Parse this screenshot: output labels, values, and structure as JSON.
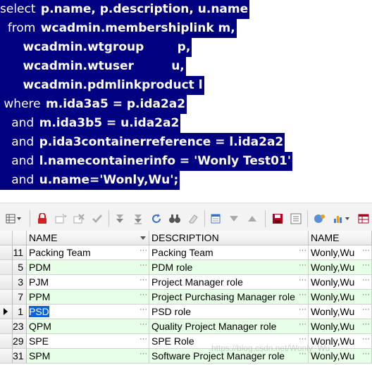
{
  "sql": {
    "lines": [
      {
        "kw": "select",
        "rest": "p.name, p.description, u.name"
      },
      {
        "kw": "from",
        "rest": "wcadmin.membershiplink m,"
      },
      {
        "kw": "",
        "rest": "wcadmin.wtgroup        p,"
      },
      {
        "kw": "",
        "rest": "wcadmin.wtuser         u,"
      },
      {
        "kw": "",
        "rest": "wcadmin.pdmlinkproduct l"
      },
      {
        "kw": "where",
        "rest": "m.ida3a5 = p.ida2a2"
      },
      {
        "kw": "and",
        "rest": "m.ida3b5 = u.ida2a2"
      },
      {
        "kw": "and",
        "rest": "p.ida3containerreference = l.ida2a2"
      },
      {
        "kw": "and",
        "rest": "l.namecontainerinfo = 'Wonly Test01'"
      },
      {
        "kw": "and",
        "rest": "u.name='Wonly,Wu';"
      }
    ]
  },
  "toolbar": {
    "icons": [
      "grid-options-icon",
      "lock-icon",
      "add-record-icon",
      "delete-record-icon",
      "post-icon",
      "filter-down-icon",
      "filter-down2-icon",
      "refresh-icon",
      "find-icon",
      "clear-icon",
      "export-icon",
      "triangle-down-icon",
      "triangle-up-icon",
      "save-icon",
      "query-by-example-icon",
      "chart-icon",
      "table-icon"
    ],
    "colors": {
      "lock": "#cc2222",
      "save": "#b00020",
      "accent": "#3a6fd0"
    }
  },
  "grid": {
    "columns": [
      "NAME",
      "DESCRIPTION",
      "NAME"
    ],
    "rows": [
      {
        "num": "11",
        "name": "Packing Team",
        "description": "Packing Team",
        "user": "Wonly,Wu",
        "shade": "#ffffff",
        "current": false
      },
      {
        "num": "5",
        "name": "PDM",
        "description": "PDM role",
        "user": "Wonly,Wu",
        "shade": "#e6ffe6",
        "current": false
      },
      {
        "num": "3",
        "name": "PJM",
        "description": "Project Manager role",
        "user": "Wonly,Wu",
        "shade": "#ffffff",
        "current": false
      },
      {
        "num": "7",
        "name": "PPM",
        "description": "Project Purchasing Manager role",
        "user": "Wonly,Wu",
        "shade": "#e6ffe6",
        "current": false
      },
      {
        "num": "1",
        "name": "PSD",
        "description": "PSD role",
        "user": "Wonly,Wu",
        "shade": "#ffffff",
        "current": true
      },
      {
        "num": "23",
        "name": "QPM",
        "description": "Quality Project Manager role",
        "user": "Wonly,Wu",
        "shade": "#e6ffe6",
        "current": false
      },
      {
        "num": "29",
        "name": "SPE",
        "description": "SPE Role",
        "user": "Wonly,Wu",
        "shade": "#ffffff",
        "current": false
      },
      {
        "num": "31",
        "name": "SPM",
        "description": "Software Project Manager role",
        "user": "Wonly,Wu",
        "shade": "#e6ffe6",
        "current": false
      }
    ]
  }
}
